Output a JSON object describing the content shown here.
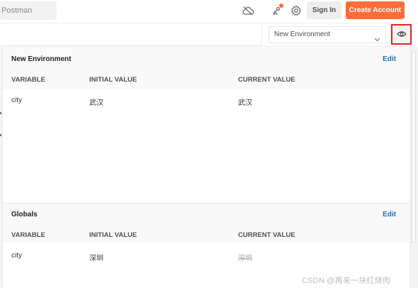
{
  "topbar": {
    "search_text": "Postman",
    "sign_in_label": "Sign In",
    "create_account_label": "Create Account",
    "accent_color": "#ff6c37"
  },
  "env_selector": {
    "selected": "New Environment"
  },
  "environment": {
    "title": "New Environment",
    "edit_label": "Edit",
    "columns": [
      "VARIABLE",
      "INITIAL VALUE",
      "CURRENT VALUE"
    ],
    "rows": [
      {
        "variable": "city",
        "initial": "武汉",
        "current": "武汉"
      }
    ]
  },
  "globals": {
    "title": "Globals",
    "edit_label": "Edit",
    "columns": [
      "VARIABLE",
      "INITIAL VALUE",
      "CURRENT VALUE"
    ],
    "rows": [
      {
        "variable": "city",
        "initial": "深圳",
        "current": "深圳"
      }
    ]
  },
  "watermark": "CSDN @再来一块红烧肉"
}
